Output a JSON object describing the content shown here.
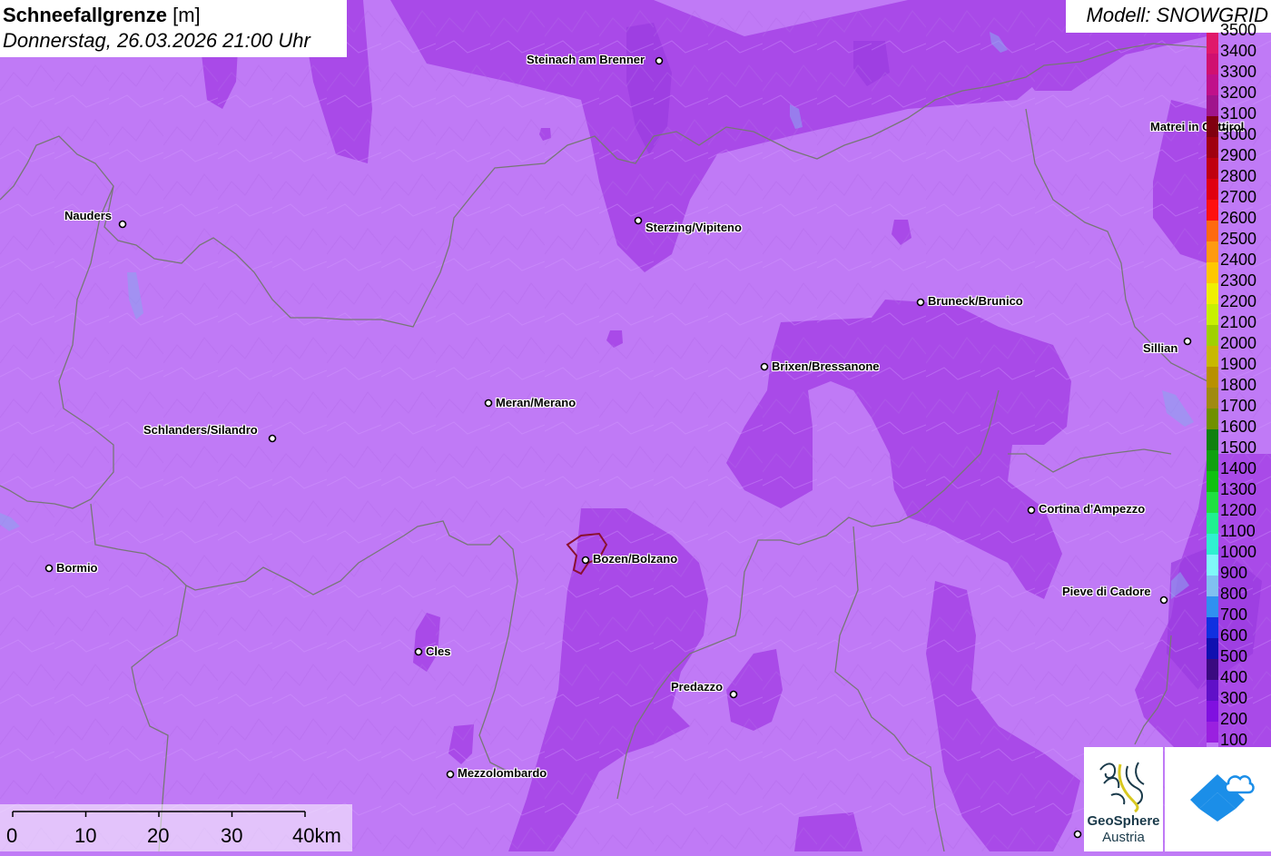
{
  "header": {
    "parameter": "Schneefallgrenze",
    "unit": "[m]",
    "datetime": "Donnerstag, 26.03.2026 21:00 Uhr"
  },
  "model_label": "Modell: SNOWGRID",
  "cities": [
    {
      "name": "Steinach am Brenner"
    },
    {
      "name": "Matrei in Osttirol"
    },
    {
      "name": "Nauders"
    },
    {
      "name": "Sterzing/Vipiteno"
    },
    {
      "name": "Bruneck/Brunico"
    },
    {
      "name": "Sillian"
    },
    {
      "name": "Brixen/Bressanone"
    },
    {
      "name": "Meran/Merano"
    },
    {
      "name": "Schlanders/Silandro"
    },
    {
      "name": "Cortina d'Ampezzo"
    },
    {
      "name": "Bormio"
    },
    {
      "name": "Bozen/Bolzano"
    },
    {
      "name": "Pieve di Cadore"
    },
    {
      "name": "Cles"
    },
    {
      "name": "Predazzo"
    },
    {
      "name": "Mezzolombardo"
    }
  ],
  "legend": {
    "labels": [
      "3500",
      "3400",
      "3300",
      "3200",
      "3100",
      "3000",
      "2900",
      "2800",
      "2700",
      "2600",
      "2500",
      "2400",
      "2300",
      "2200",
      "2100",
      "2000",
      "1900",
      "1800",
      "1700",
      "1600",
      "1500",
      "1400",
      "1300",
      "1200",
      "1100",
      "1000",
      "900",
      "800",
      "700",
      "600",
      "500",
      "400",
      "300",
      "200",
      "100"
    ],
    "colors": [
      "#e0186a",
      "#d01070",
      "#c0108a",
      "#a0148c",
      "#800010",
      "#a00010",
      "#c00010",
      "#e00010",
      "#ff1010",
      "#ff6a10",
      "#ff9a10",
      "#ffc800",
      "#f0f000",
      "#c8f000",
      "#a0d000",
      "#c8b800",
      "#b89000",
      "#a08a10",
      "#709000",
      "#108010",
      "#10a010",
      "#10c010",
      "#20e040",
      "#20f090",
      "#30f0d0",
      "#80f8f8",
      "#80c0f0",
      "#3090f0",
      "#1030e0",
      "#1010b0",
      "#3a0a80",
      "#6010c8",
      "#8010e0",
      "#9a20e0",
      "#c07af6"
    ]
  },
  "scale_bar": {
    "labels": [
      "0",
      "10",
      "20",
      "30",
      "40km"
    ]
  },
  "logo": {
    "line1": "GeoSphere",
    "line2": "Austria"
  }
}
